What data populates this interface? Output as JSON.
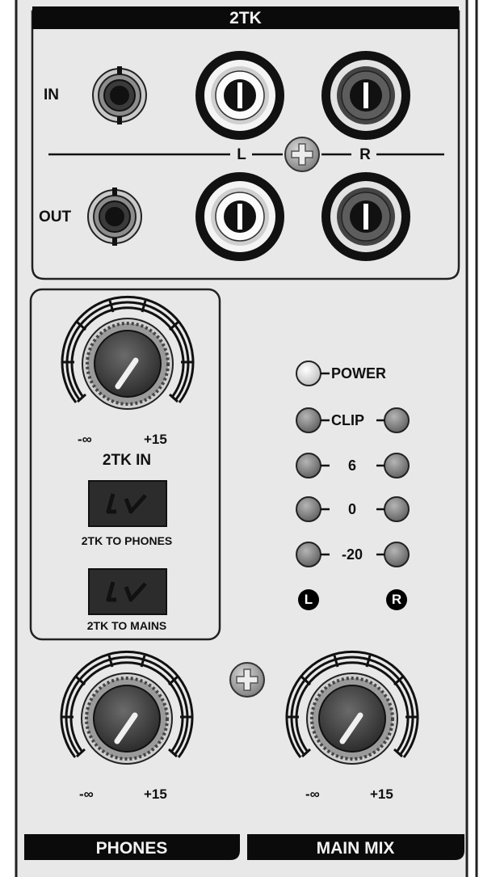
{
  "section": {
    "title": "2TK",
    "in_label": "IN",
    "out_label": "OUT",
    "left_label": "L",
    "right_label": "R"
  },
  "knobs": {
    "min_label": "-∞",
    "max_label": "+15"
  },
  "controls": {
    "tk_in_label": "2TK IN",
    "tk_to_phones_label": "2TK TO PHONES",
    "tk_to_mains_label": "2TK TO MAINS"
  },
  "meter": {
    "power_label": "POWER",
    "clip_label": "CLIP",
    "level_6": "6",
    "level_0": "0",
    "level_minus20": "-20",
    "left_badge": "L",
    "right_badge": "R"
  },
  "footer": {
    "phones_label": "PHONES",
    "main_mix_label": "MAIN MIX"
  },
  "colors": {
    "panel": "#e8e8e8",
    "bar": "#0b0b0b",
    "led": "#8a8a8a",
    "power_led": "#e0e0e0"
  }
}
